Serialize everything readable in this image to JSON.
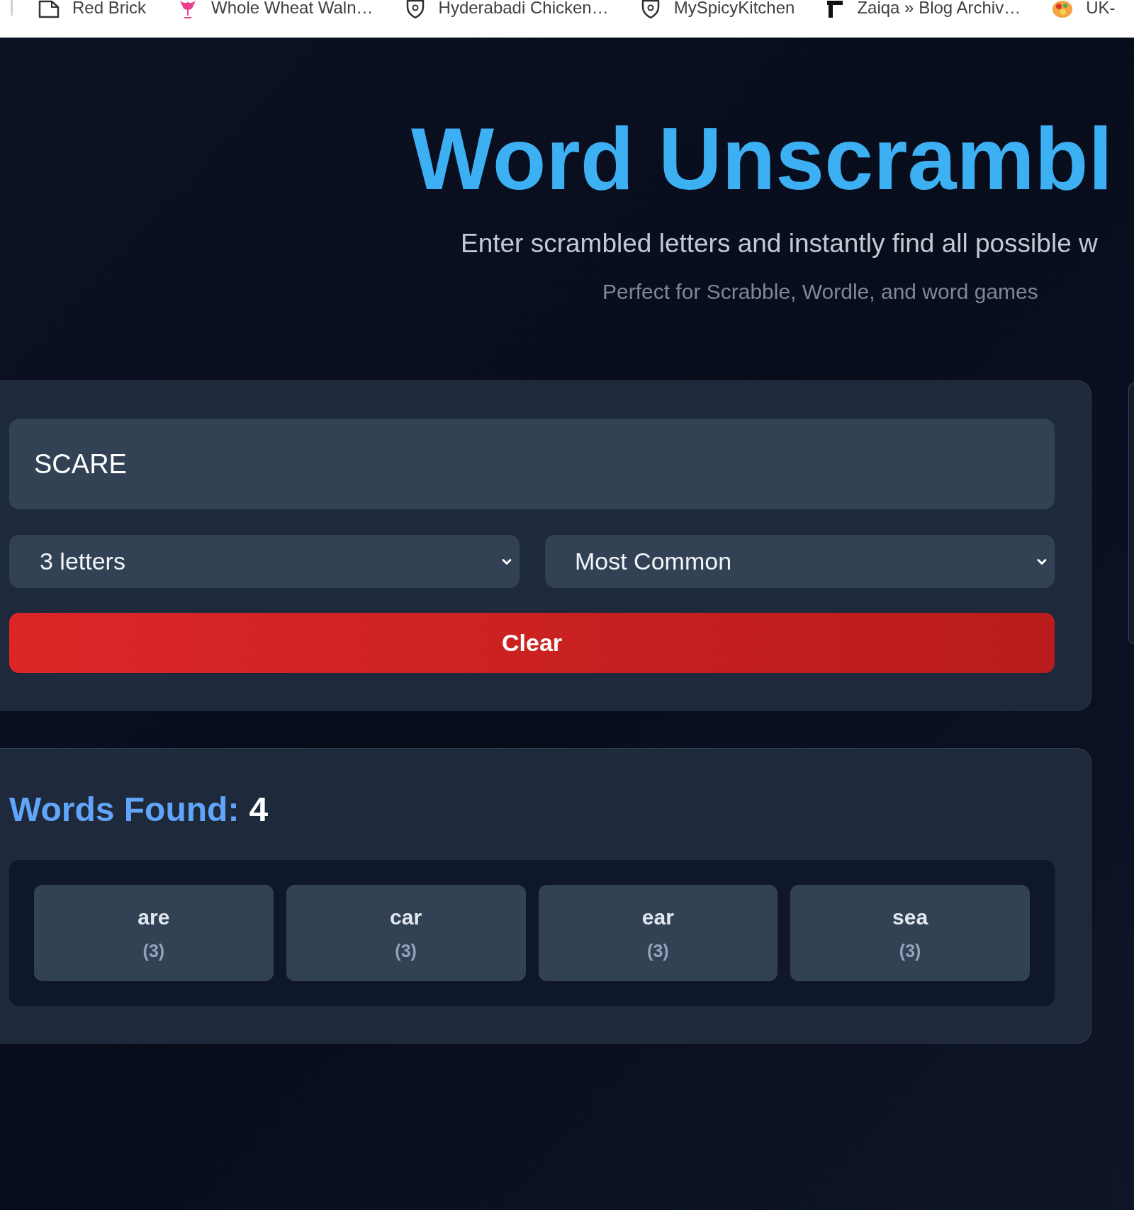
{
  "bookmarks_bar": {
    "items": [
      {
        "label": "Red Brick"
      },
      {
        "label": "Whole Wheat Waln…"
      },
      {
        "label": "Hyderabadi Chicken…"
      },
      {
        "label": "MySpicyKitchen"
      },
      {
        "label": "Zaiqa » Blog Archiv…"
      },
      {
        "label": "UK-"
      }
    ]
  },
  "header": {
    "title": "Word Unscrambl",
    "subtitle": "Enter scrambled letters and instantly find all possible w",
    "tagline": "Perfect for Scrabble, Wordle, and word games"
  },
  "search_panel": {
    "letters_input": {
      "value": "SCARE"
    },
    "length_select": {
      "value": "3 letters"
    },
    "sort_select": {
      "value": "Most Common"
    },
    "clear_button": {
      "label": "Clear"
    }
  },
  "results": {
    "heading": "Words Found:",
    "count": "4",
    "words": [
      {
        "word": "are",
        "length": "(3)"
      },
      {
        "word": "car",
        "length": "(3)"
      },
      {
        "word": "ear",
        "length": "(3)"
      },
      {
        "word": "sea",
        "length": "(3)"
      }
    ]
  }
}
